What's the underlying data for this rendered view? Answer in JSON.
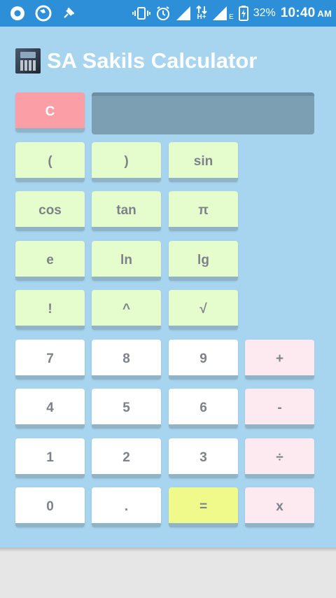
{
  "status_bar": {
    "battery_percent": "32%",
    "time": "10:40",
    "ampm": "AM",
    "network_label": "H+",
    "network_label_2": "E"
  },
  "header": {
    "title": "SA Sakils Calculator"
  },
  "display": {
    "value": ""
  },
  "buttons": {
    "clear": "C",
    "open_paren": "(",
    "close_paren": ")",
    "sin": "sin",
    "cos": "cos",
    "tan": "tan",
    "pi": "π",
    "e": "e",
    "ln": "ln",
    "lg": "lg",
    "factorial": "!",
    "power": "^",
    "sqrt": "√",
    "seven": "7",
    "eight": "8",
    "nine": "9",
    "plus": "+",
    "four": "4",
    "five": "5",
    "six": "6",
    "minus": "-",
    "one": "1",
    "two": "2",
    "three": "3",
    "divide": "÷",
    "zero": "0",
    "dot": ".",
    "equals": "=",
    "multiply": "x"
  },
  "colors": {
    "status_bar": "#2d8fd8",
    "app_background": "#a7d4ee",
    "scientific_key": "#e5fccd",
    "number_key": "#ffffff",
    "operator_key": "#fdeaf0",
    "equals_key": "#f0fa8a",
    "clear_key": "#fb9ea6",
    "display": "#7c9fb3"
  }
}
